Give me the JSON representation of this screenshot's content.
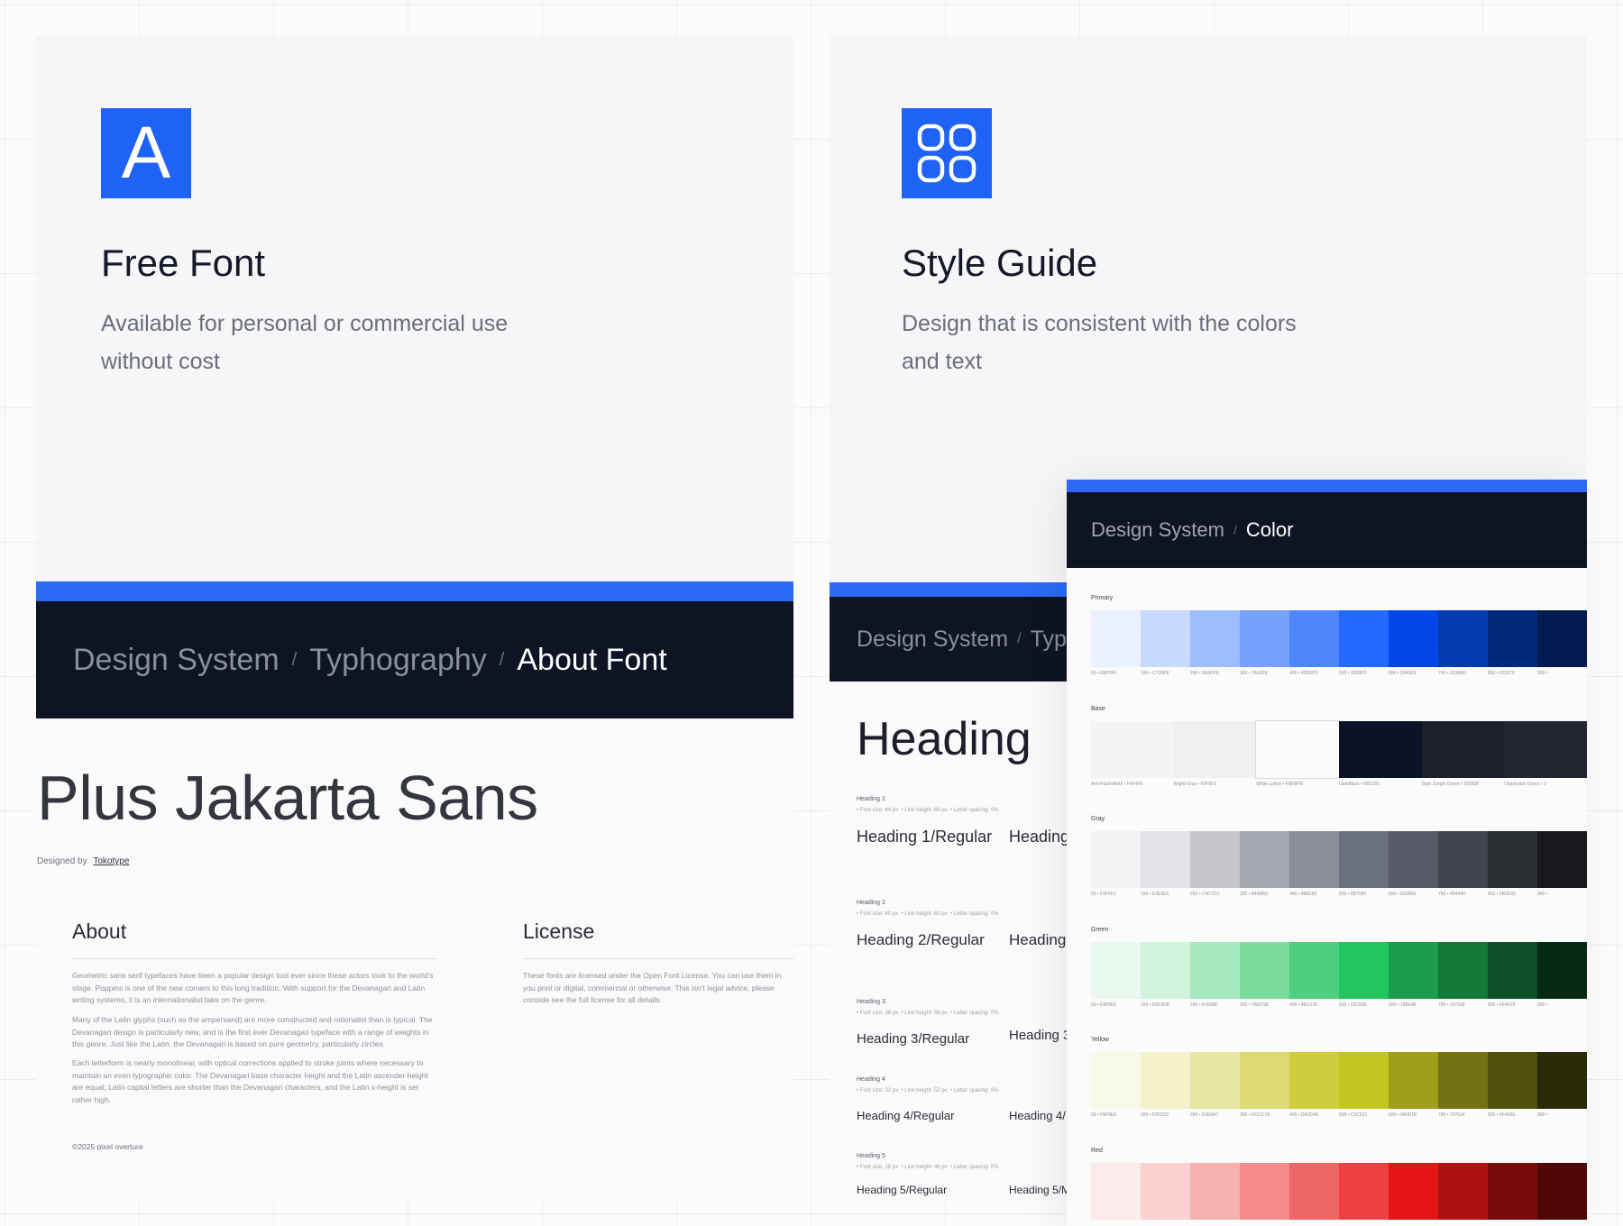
{
  "free_font": {
    "logo_letter": "A",
    "title": "Free Font",
    "description": "Available for personal or commercial use without cost"
  },
  "style_guide": {
    "logo_icon": "four-rounded-squares-icon",
    "title": "Style Guide",
    "description": "Design that is consistent with the colors and text"
  },
  "about_font": {
    "breadcrumb": [
      "Design System",
      "Typhography",
      "About Font"
    ],
    "font_name": "Plus Jakarta Sans",
    "designed_by_label": "Designed by",
    "designer": "Tokotype",
    "about_title": "About",
    "about_paragraphs": [
      "Geometric sans serif typefaces have been a popular design tool ever since these actors took to the world's stage. Poppins is one of the new comers to this long tradition. With support for the Devanagari and Latin writing systems, it is an internationalist take on the genre.",
      "Many of the Latin glyphs (such as the ampersand) are more constructed and rationalist than is typical. The Devanagari design is particularly new, and is the first ever Devanagari typeface with a range of weights in this genre. Just like the Latin, the Devanagari is based on pure geometry, particularly circles.",
      "Each letterform is nearly monolinear, with optical corrections applied to stroke joints where necessary to maintain an even typographic color. The Devanagari base character height and the Latin ascender height are equal; Latin capital letters are shorter than the Devanagari characters, and the Latin x-height is set rather high."
    ],
    "license_title": "License",
    "license_text": "These fonts are licensed under the Open Font License. You can use them in you print or digital, commercial or otherwise. This isn't legal advice, please conside see the full license for all details.",
    "copyright": "©2025 pixel overture"
  },
  "typography_preview": {
    "breadcrumb": [
      "Design System",
      "Typ"
    ],
    "heading": "Heading",
    "levels": [
      {
        "label": "Heading 1",
        "meta": [
          "Font size:  44 px",
          "Line height:  68 px",
          "Letter spacing:  0%"
        ],
        "regular": "Heading 1/Regular",
        "alt": "Heading"
      },
      {
        "label": "Heading 2",
        "meta": [
          "Font size:  40 px",
          "Line height:  62 px",
          "Letter spacing:  0%"
        ],
        "regular": "Heading 2/Regular",
        "alt": "Heading"
      },
      {
        "label": "Heading 3",
        "meta": [
          "Font size:  36 px",
          "Line height:  58 px",
          "Letter spacing:  0%"
        ],
        "regular": "Heading 3/Regular",
        "alt": "Heading 3"
      },
      {
        "label": "Heading 4",
        "meta": [
          "Font size:  32 px",
          "Line height:  52 px",
          "Letter spacing:  0%"
        ],
        "regular": "Heading 4/Regular",
        "alt": "Heading 4/"
      },
      {
        "label": "Heading 5",
        "meta": [
          "Font size:  28 px",
          "Line height:  46 px",
          "Letter spacing:  0%"
        ],
        "regular": "Heading 5/Regular",
        "alt": "Heading 5/M"
      }
    ]
  },
  "color_panel": {
    "breadcrumb": [
      "Design System",
      "Color"
    ],
    "palettes": [
      {
        "name": "Primary",
        "swatches": [
          "#ebf1ff",
          "#c7d9fe",
          "#9ebdfe",
          "#76a2fe",
          "#4d86fd",
          "#2568fd",
          "#0245e8",
          "#023ab0",
          "#012879",
          "#011a4f"
        ],
        "codes": [
          "50 • EBF0FF",
          "100 • C7D9FE",
          "200 • 9EBDFE",
          "300 • 76A2FE",
          "400 • 4D86FD",
          "500 • 2568FD",
          "600 • 0245E8",
          "700 • 023AB0",
          "800 • 012879",
          "900 •"
        ]
      },
      {
        "name": "Base",
        "swatches": [
          "#f4f4f6",
          "#f0f0f2",
          "#fbfbfb",
          "#0b1326",
          "#1d1f2a",
          "#24262f"
        ],
        "codes": [
          "Anti-FlashWhite • F4F4F6",
          "Bright Gray • F0F0F2",
          "White Lotion • FBFBFB",
          "DarkBlack • 0B1326",
          "Dark Jungle Green • 232938",
          "Charleston Green • 2"
        ]
      },
      {
        "name": "Gray",
        "swatches": [
          "#f2f3f5",
          "#e3e4e7",
          "#c4c6cc",
          "#a4a7b0",
          "#898e99",
          "#6b7080",
          "#565a66",
          "#40444d",
          "#2b2e33",
          "#17191c"
        ],
        "codes": [
          "50 • F3F5F2",
          "100 • E3E3E6",
          "200 • C4C7CC",
          "300 • A4A8B3",
          "400 • 898E99",
          "500 • 6B7080",
          "600 • 565B66",
          "700 • 40444D",
          "800 • 2B2E33",
          "900 •"
        ]
      },
      {
        "name": "Green",
        "swatches": [
          "#e9f9ef",
          "#d0f3dc",
          "#a7e9be",
          "#7ddb9e",
          "#4ece7e",
          "#22c55e",
          "#1a9e4b",
          "#147938",
          "#0d4f26",
          "#072a14"
        ],
        "codes": [
          "50 • E9F9EF",
          "100 • D0F3DB",
          "200 • A7E9BF",
          "300 • 7ADC9E",
          "400 • 4ED17E",
          "500 • 22C55E",
          "600 • 189E4B",
          "700 • 147938",
          "800 • 0E4F26",
          "900 •"
        ]
      },
      {
        "name": "Yellow",
        "swatches": [
          "#f9f9e9",
          "#f3f2cb",
          "#e6e6a5",
          "#dcda70",
          "#d0cc3e",
          "#c5c522",
          "#9e9e1b",
          "#737314",
          "#4f4f0e",
          "#2a2a07"
        ],
        "codes": [
          "50 • F9F9E9",
          "100 • F3F2D3",
          "200 • E6E8A7",
          "300 • DCDC7A",
          "400 • D0CD4E",
          "500 • C5C522",
          "600 • 9A9E1B",
          "700 • 737614",
          "800 • 4F4F0E",
          "900 •"
        ]
      },
      {
        "name": "Red",
        "swatches": [
          "#fdebeb",
          "#fbd0d0",
          "#f8b1b1",
          "#f48a8a",
          "#f06666",
          "#ee4040",
          "#e51515",
          "#b01010",
          "#7a0b0b",
          "#4f0707"
        ],
        "codes": []
      }
    ]
  },
  "colors": {
    "accent": "#2b6af6",
    "navy": "#0f1425"
  }
}
